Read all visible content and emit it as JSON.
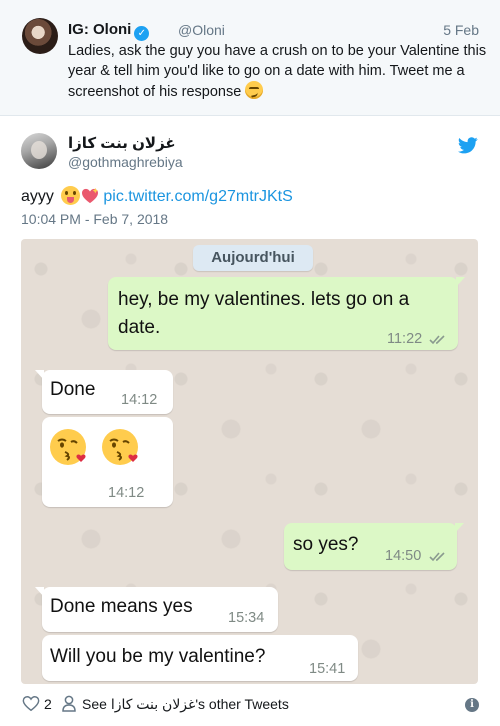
{
  "quoted_tweet": {
    "display_name": "IG: Oloni",
    "verified_icon": "verified-badge-icon",
    "handle": "@Oloni",
    "date": "5 Feb",
    "text": "Ladies, ask the guy you have a crush on to be your Valentine this year & tell him you'd like to go on a date with him. Tweet me a screenshot of his response",
    "emoji": "smirking-face-emoji"
  },
  "tweet": {
    "display_name": "غزلان بنت كازا",
    "handle": "@gothmaghrebiya",
    "text": "ayyy",
    "emojis": [
      "face-with-tongue-emoji",
      "sparkling-heart-emoji"
    ],
    "link": "pic.twitter.com/g27mtrJKtS",
    "timestamp": "10:04 PM - Feb 7, 2018",
    "platform_icon": "twitter-bird-icon"
  },
  "chat": {
    "date_label": "Aujourd'hui",
    "messages": [
      {
        "direction": "outgoing",
        "text": "hey, be my valentines. lets go on a date.",
        "time": "11:22",
        "status_icon": "double-check-icon"
      },
      {
        "direction": "incoming",
        "text": "Done",
        "time": "14:12"
      },
      {
        "direction": "incoming",
        "emojis": [
          "face-throwing-kiss-emoji",
          "face-throwing-kiss-emoji"
        ],
        "time": "14:12"
      },
      {
        "direction": "outgoing",
        "text": "so yes?",
        "time": "14:50",
        "status_icon": "double-check-icon"
      },
      {
        "direction": "incoming",
        "text": "Done means yes",
        "time": "15:34"
      },
      {
        "direction": "incoming",
        "text": "Will you be my valentine?",
        "time": "15:41"
      }
    ],
    "colors": {
      "outgoing": "#dcf8c6",
      "incoming": "#ffffff",
      "background": "#e5ddd5",
      "date_chip": "#dde9f3"
    }
  },
  "footer": {
    "like_count": "2",
    "see_tweets_prefix": "See ",
    "see_tweets_name": "غزلان بنت كازا",
    "see_tweets_suffix": "'s other Tweets",
    "info_icon": "info-icon"
  },
  "colors": {
    "link": "#1b95e0",
    "muted": "#657786",
    "twitter_blue": "#1da1f2"
  }
}
